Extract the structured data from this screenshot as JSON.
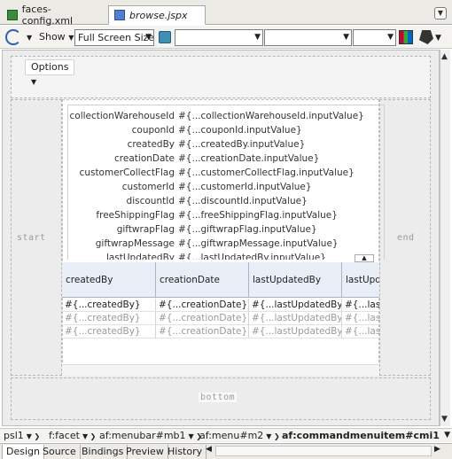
{
  "editor_tabs": [
    {
      "label": "faces-config.xml",
      "icon": "xml-file-icon",
      "active": false
    },
    {
      "label": "browse.jspx",
      "icon": "jspx-file-icon",
      "active": true
    }
  ],
  "toolbar": {
    "show_label": "Show",
    "screen_size": "Full Screen Size",
    "empty_selects": [
      "",
      "",
      ""
    ]
  },
  "options_menu": "Options",
  "facets": {
    "start": "start",
    "end": "end",
    "bottom": "bottom"
  },
  "form_fields": [
    {
      "label": "collectionWarehouseId",
      "value": "#{...collectionWarehouseId.inputValue}"
    },
    {
      "label": "couponId",
      "value": "#{...couponId.inputValue}"
    },
    {
      "label": "createdBy",
      "value": "#{...createdBy.inputValue}"
    },
    {
      "label": "creationDate",
      "value": "#{...creationDate.inputValue}"
    },
    {
      "label": "customerCollectFlag",
      "value": "#{...customerCollectFlag.inputValue}"
    },
    {
      "label": "customerId",
      "value": "#{...customerId.inputValue}"
    },
    {
      "label": "discountId",
      "value": "#{...discountId.inputValue}"
    },
    {
      "label": "freeShippingFlag",
      "value": "#{...freeShippingFlag.inputValue}"
    },
    {
      "label": "giftwrapFlag",
      "value": "#{...giftwrapFlag.inputValue}"
    },
    {
      "label": "giftwrapMessage",
      "value": "#{...giftwrapMessage.inputValue}"
    },
    {
      "label": "lastUpdatedBy",
      "value": "#{...lastUpdatedBy.inputValue}"
    }
  ],
  "table": {
    "columns": [
      "createdBy",
      "creationDate",
      "lastUpdatedBy",
      "lastUpda"
    ],
    "rows": [
      [
        "#{...createdBy}",
        "#{...creationDate}",
        "#{...lastUpdatedBy}",
        "#{...lastU"
      ],
      [
        "#{...createdBy}",
        "#{...creationDate}",
        "#{...lastUpdatedBy}",
        "#{...lastU"
      ],
      [
        "#{...createdBy}",
        "#{...creationDate}",
        "#{...lastUpdatedBy}",
        "#{...lastU"
      ]
    ]
  },
  "breadcrumb": [
    "psl1",
    "f:facet",
    "af:menubar#mb1",
    "af:menu#m2",
    "af:commandmenuitem#cmi1"
  ],
  "bottom_tabs": [
    "Design",
    "Source",
    "Bindings",
    "Preview",
    "History"
  ],
  "active_bottom_tab": "Design"
}
